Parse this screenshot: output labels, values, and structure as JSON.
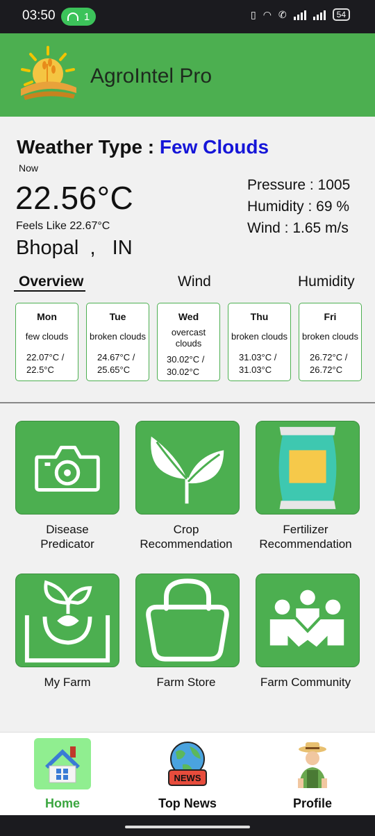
{
  "status": {
    "time": "03:50",
    "hotspot_count": "1",
    "battery": "54"
  },
  "app": {
    "title": "AgroIntel Pro"
  },
  "weather": {
    "type_label": "Weather Type :",
    "type_value": "Few Clouds",
    "now": "Now",
    "temp": "22.56°C",
    "feels": "Feels Like 22.67°C",
    "city": "Bhopal",
    "sep": ",",
    "country": "IN",
    "pressure": "Pressure : 1005",
    "humidity": "Humidity : 69 %",
    "wind": "Wind :  1.65 m/s"
  },
  "tabs": [
    "Overview",
    "Wind",
    "Humidity"
  ],
  "forecast": [
    {
      "day": "Mon",
      "desc": "few clouds",
      "t1": "22.07°C  /",
      "t2": "22.5°C"
    },
    {
      "day": "Tue",
      "desc": "broken clouds",
      "t1": "24.67°C  /",
      "t2": "25.65°C"
    },
    {
      "day": "Wed",
      "desc": "overcast clouds",
      "t1": "30.02°C  /",
      "t2": "30.02°C"
    },
    {
      "day": "Thu",
      "desc": "broken clouds",
      "t1": "31.03°C  /",
      "t2": "31.03°C"
    },
    {
      "day": "Fri",
      "desc": "broken clouds",
      "t1": "26.72°C  /",
      "t2": "26.72°C"
    }
  ],
  "tiles": [
    {
      "line1": "Disease",
      "line2": "Predicator",
      "icon": "camera-icon"
    },
    {
      "line1": "Crop",
      "line2": "Recommendation",
      "icon": "sprout-icon"
    },
    {
      "line1": "Fertilizer",
      "line2": "Recommendation",
      "icon": "fertilizer-bag-icon"
    },
    {
      "line1": "My Farm",
      "line2": "",
      "icon": "seedling-soil-icon"
    },
    {
      "line1": "Farm Store",
      "line2": "",
      "icon": "shopping-bag-icon"
    },
    {
      "line1": "Farm Community",
      "line2": "",
      "icon": "community-icon"
    }
  ],
  "nav": [
    {
      "label": "Home",
      "icon": "house-icon",
      "active": true
    },
    {
      "label": "Top News",
      "icon": "news-globe-icon",
      "badge": "NEWS"
    },
    {
      "label": "Profile",
      "icon": "farmer-icon"
    }
  ],
  "colors": {
    "brand_green": "#4caf50",
    "weather_type": "#1515d8",
    "nav_active": "#3aa63f",
    "nav_active_bg": "#90ee90"
  }
}
